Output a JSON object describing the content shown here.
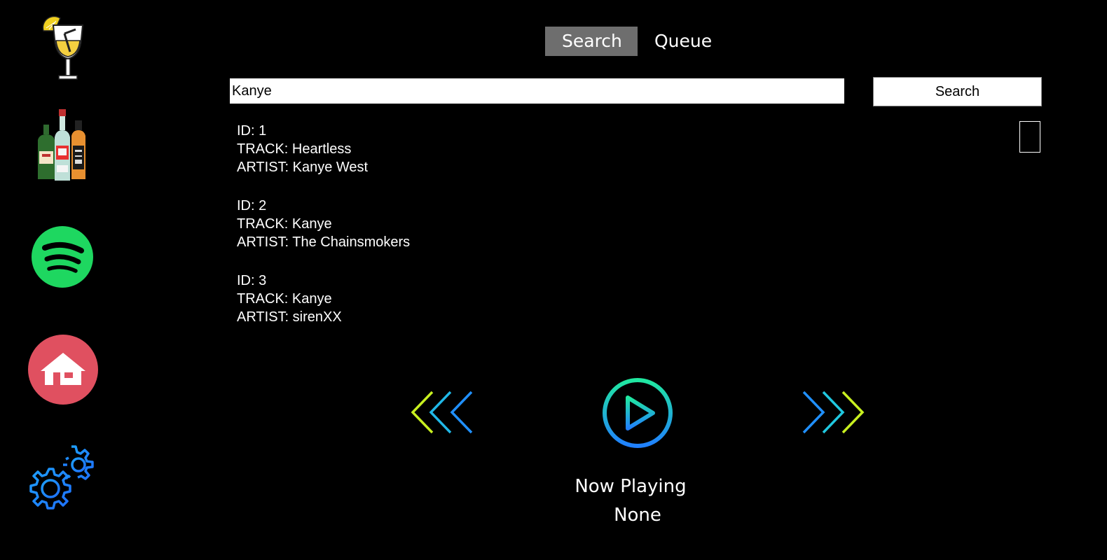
{
  "tabs": {
    "search_label": "Search",
    "queue_label": "Queue",
    "active": "search"
  },
  "search": {
    "query": "Kanye",
    "button_label": "Search"
  },
  "results": [
    {
      "id_line": "ID: 1",
      "track_line": "TRACK: Heartless",
      "artist_line": "ARTIST: Kanye West"
    },
    {
      "id_line": "ID: 2",
      "track_line": "TRACK: Kanye",
      "artist_line": "ARTIST: The Chainsmokers"
    },
    {
      "id_line": "ID: 3",
      "track_line": "TRACK: Kanye",
      "artist_line": "ARTIST: sirenXX"
    }
  ],
  "now_playing": {
    "label": "Now Playing",
    "value": "None"
  },
  "sidebar": {
    "items": [
      {
        "icon": "cocktail-icon"
      },
      {
        "icon": "bottles-icon"
      },
      {
        "icon": "spotify-icon"
      },
      {
        "icon": "home-icon"
      },
      {
        "icon": "settings-icon"
      }
    ]
  },
  "colors": {
    "background": "#000000",
    "active_tab": "#6e6e6e",
    "spotify_green": "#1ed760",
    "home_red": "#e05060",
    "settings_blue": "#1e90ff",
    "chevron_lime": "#c8f020",
    "chevron_cyan": "#20b8e8",
    "play_gradient_start": "#20e8a0",
    "play_gradient_end": "#2080ff"
  }
}
